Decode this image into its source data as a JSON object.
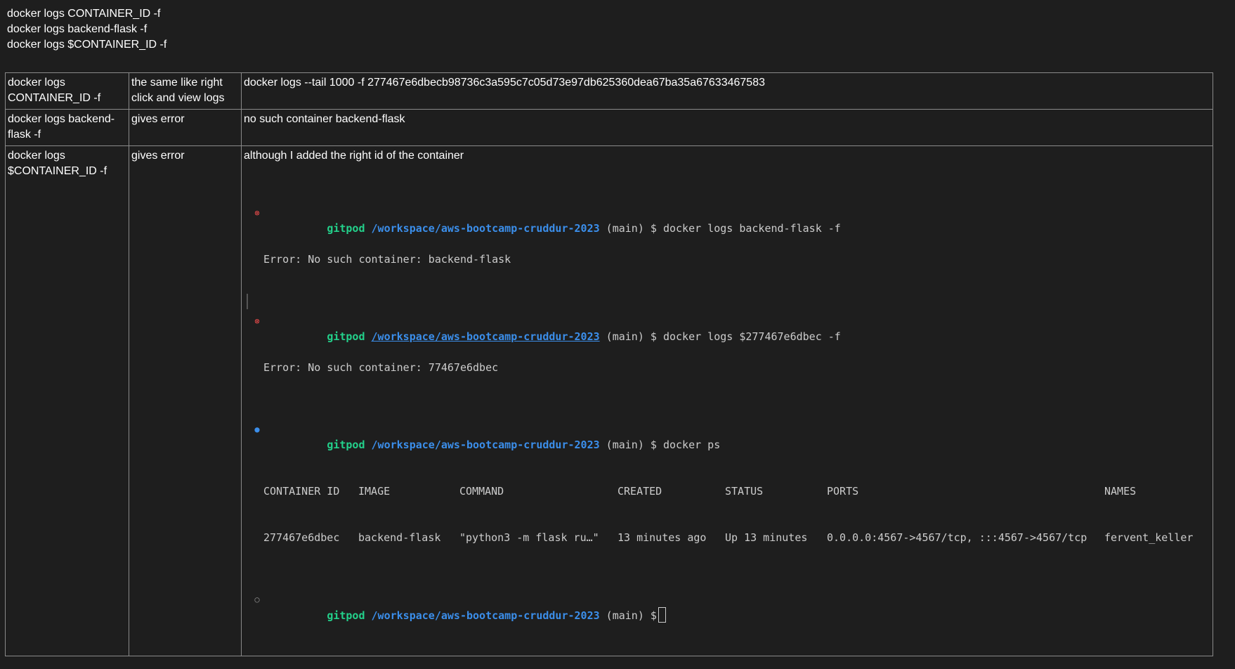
{
  "intro_lines": [
    "docker logs CONTAINER_ID -f",
    "docker logs backend-flask -f",
    "docker logs $CONTAINER_ID -f"
  ],
  "table": {
    "rows": [
      {
        "command": "docker logs CONTAINER_ID -f",
        "result": "the same like right click and view logs",
        "notes": "docker logs --tail 1000 -f 277467e6dbecb98736c3a595c7c05d73e97db625360dea67ba35a67633467583"
      },
      {
        "command": "docker logs backend-flask -f",
        "result": "gives error",
        "notes": "no such container backend-flask"
      },
      {
        "command": "docker logs $CONTAINER_ID -f",
        "result": "gives error",
        "notes": "although I added the right id of the container"
      }
    ]
  },
  "terminal": {
    "user": "gitpod",
    "path": "/workspace/aws-bootcamp-cruddur-2023",
    "branch": "(main) $",
    "lines": [
      {
        "cmd": "docker logs backend-flask -f",
        "output": "Error: No such container: backend-flask"
      },
      {
        "cmd": "docker logs $277467e6dbec -f",
        "output": "Error: No such container: 77467e6dbec"
      },
      {
        "cmd": "docker ps"
      }
    ],
    "ps_headers": {
      "container_id": "CONTAINER ID",
      "image": "IMAGE",
      "command": "COMMAND",
      "created": "CREATED",
      "status": "STATUS",
      "ports": "PORTS",
      "names": "NAMES"
    },
    "ps_row": {
      "container_id": "277467e6dbec",
      "image": "backend-flask",
      "command": "\"python3 -m flask ru…\"",
      "created": "13 minutes ago",
      "status": "Up 13 minutes",
      "ports": "0.0.0.0:4567->4567/tcp, :::4567->4567/tcp",
      "names": "fervent_keller"
    },
    "bullets": {
      "error": "⊗",
      "success": "●",
      "idle": "○"
    },
    "colors": {
      "user": "#23d18b",
      "path": "#3b8eea",
      "error_bullet": "#f14c4c"
    }
  }
}
